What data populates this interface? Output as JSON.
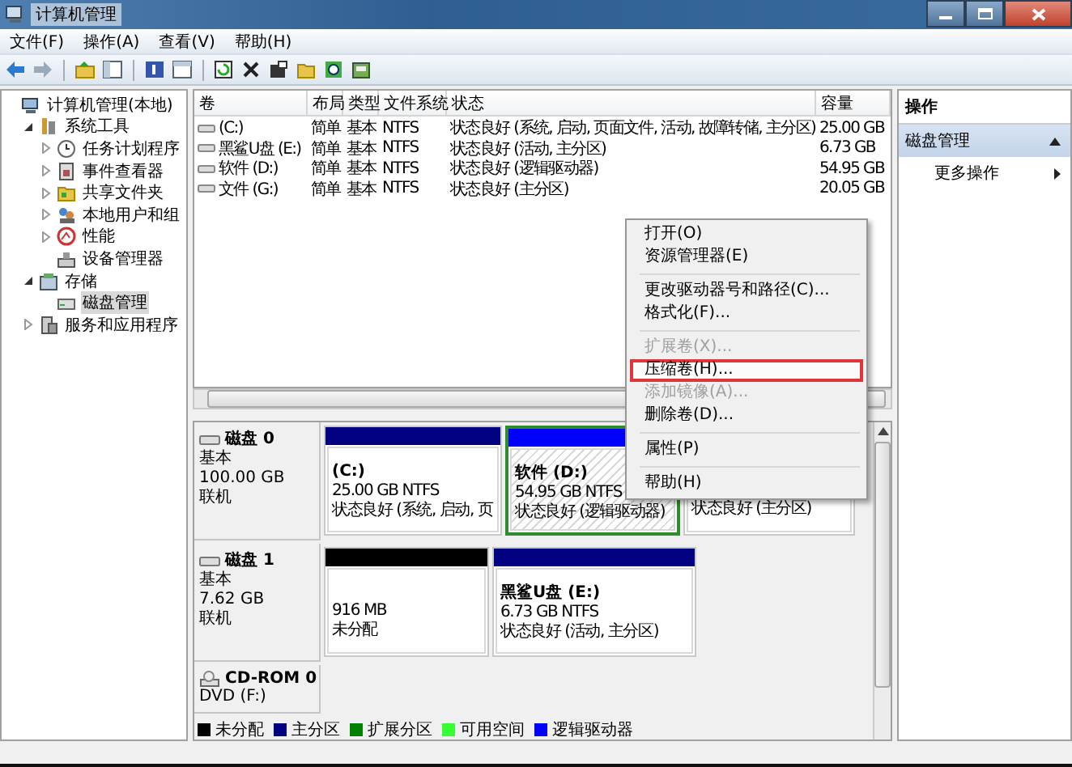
{
  "window": {
    "title": "计算机管理"
  },
  "menu_bar": [
    "文件(F)",
    "操作(A)",
    "查看(V)",
    "帮助(H)"
  ],
  "tree": [
    {
      "label": "计算机管理(本地)",
      "children": [
        {
          "label": "系统工具",
          "expanded": true,
          "children": [
            {
              "label": "任务计划程序",
              "expanded": false
            },
            {
              "label": "事件查看器",
              "expanded": false
            },
            {
              "label": "共享文件夹",
              "expanded": false
            },
            {
              "label": "本地用户和组",
              "expanded": false
            },
            {
              "label": "性能",
              "expanded": false
            },
            {
              "label": "设备管理器"
            }
          ]
        },
        {
          "label": "存储",
          "expanded": true,
          "children": [
            {
              "label": "磁盘管理",
              "selected": true
            }
          ]
        },
        {
          "label": "服务和应用程序",
          "expanded": false
        }
      ]
    }
  ],
  "volumes": {
    "columns": [
      "卷",
      "布局",
      "类型",
      "文件系统",
      "状态",
      "容量"
    ],
    "rows": [
      {
        "cells": [
          "(C:)",
          "简单",
          "基本",
          "NTFS",
          "状态良好 (系统, 启动, 页面文件, 活动, 故障转储, 主分区)",
          "25.00 GB"
        ]
      },
      {
        "cells": [
          "黑鲨U盘 (E:)",
          "简单",
          "基本",
          "NTFS",
          "状态良好 (活动, 主分区)",
          "6.73 GB"
        ]
      },
      {
        "cells": [
          "软件 (D:)",
          "简单",
          "基本",
          "NTFS",
          "状态良好 (逻辑驱动器)",
          "54.95 GB"
        ]
      },
      {
        "cells": [
          "文件 (G:)",
          "简单",
          "基本",
          "NTFS",
          "状态良好 (主分区)",
          "20.05 GB"
        ]
      }
    ]
  },
  "disks": [
    {
      "kind": "disk",
      "name": "磁盘 0",
      "lines": [
        "基本",
        "100.00 GB",
        "联机"
      ],
      "partitions": [
        {
          "kind": "primary",
          "selected": false,
          "title": "(C:)",
          "details": [
            "25.00 GB NTFS",
            "状态良好 (系统, 启动, 页"
          ]
        },
        {
          "kind": "logical",
          "selected": true,
          "title": "软件  (D:)",
          "details": [
            "54.95 GB NTFS",
            "状态良好 (逻辑驱动器)"
          ]
        },
        {
          "selected": false,
          "details": [
            "状态良好 (主分区)"
          ]
        }
      ]
    },
    {
      "kind": "disk",
      "name": "磁盘 1",
      "lines": [
        "基本",
        "7.62 GB",
        "联机"
      ],
      "partitions": [
        {
          "kind": "unallocated",
          "selected": false,
          "details": [
            "916 MB",
            "未分配"
          ]
        },
        {
          "kind": "primary",
          "selected": false,
          "title": "黑鲨U盘  (E:)",
          "details": [
            "6.73 GB NTFS",
            "状态良好 (活动, 主分区)"
          ]
        }
      ]
    },
    {
      "kind": "cdrom",
      "name": "CD-ROM 0",
      "lines": [
        "DVD (F:)"
      ]
    }
  ],
  "legend": [
    {
      "label": "未分配",
      "color": "#000000"
    },
    {
      "label": "主分区",
      "color": "#000080"
    },
    {
      "label": "扩展分区",
      "color": "#008000"
    },
    {
      "label": "可用空间",
      "color": "#33ff33"
    },
    {
      "label": "逻辑驱动器",
      "color": "#0000ff"
    }
  ],
  "actions": {
    "title": "操作",
    "sections": [
      {
        "label": "磁盘管理",
        "expanded": true,
        "items": [
          {
            "label": "更多操作"
          }
        ]
      }
    ]
  },
  "context_menu": [
    {
      "kind": "item",
      "label": "打开(O)",
      "disabled": false,
      "highlighted": false
    },
    {
      "kind": "item",
      "label": "资源管理器(E)",
      "disabled": false,
      "highlighted": false
    },
    {
      "kind": "separator"
    },
    {
      "kind": "item",
      "label": "更改驱动器号和路径(C)...",
      "disabled": false,
      "highlighted": false
    },
    {
      "kind": "item",
      "label": "格式化(F)...",
      "disabled": false,
      "highlighted": false
    },
    {
      "kind": "separator"
    },
    {
      "kind": "item",
      "label": "扩展卷(X)...",
      "disabled": true,
      "highlighted": false
    },
    {
      "kind": "item",
      "label": "压缩卷(H)...",
      "disabled": false,
      "highlighted": true
    },
    {
      "kind": "item",
      "label": "添加镜像(A)...",
      "disabled": true,
      "highlighted": false
    },
    {
      "kind": "item",
      "label": "删除卷(D)...",
      "disabled": false,
      "highlighted": false
    },
    {
      "kind": "separator"
    },
    {
      "kind": "item",
      "label": "属性(P)",
      "disabled": false,
      "highlighted": false
    },
    {
      "kind": "separator"
    },
    {
      "kind": "item",
      "label": "帮助(H)",
      "disabled": false,
      "highlighted": false
    }
  ]
}
